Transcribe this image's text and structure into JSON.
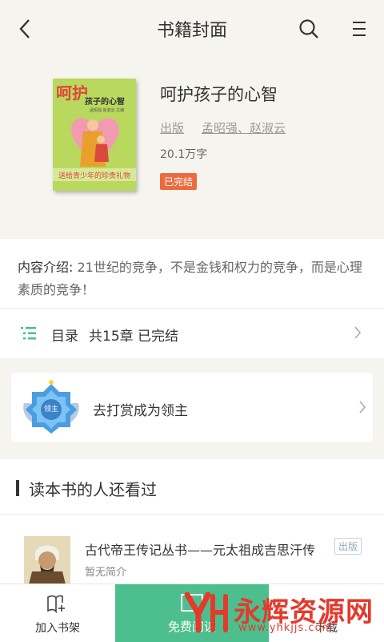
{
  "header": {
    "title": "书籍封面"
  },
  "book": {
    "title": "呵护孩子的心智",
    "publisher": "出版",
    "author": "孟昭强、赵淑云",
    "word_count": "20.1万字",
    "status": "已完结",
    "cover": {
      "big_title": "呵护",
      "sub_title": "孩子的心智",
      "tagline": "送给青少年的珍贵礼物",
      "author_line": "孟昭强 赵淑云 主编"
    }
  },
  "intro": {
    "label": "内容介绍:",
    "text": "21世纪的竞争，不是金钱和权力的竞争，而是心理素质的竞争！"
  },
  "toc": {
    "label": "目录",
    "summary": "共15章 已完结"
  },
  "reward": {
    "badge": "领主",
    "text": "去打赏成为领主"
  },
  "recommend": {
    "section_title": "读本书的人还看过",
    "items": [
      {
        "title": "古代帝王传记丛书——元太祖成吉思汗传",
        "tag": "出版",
        "desc": "暂无简介"
      }
    ]
  },
  "bottom_bar": {
    "add_shelf": "加入书架",
    "read": "免费阅读",
    "download": "下载"
  },
  "watermark": {
    "brand": "永辉资源网",
    "url": "www.yhkjjs.com"
  },
  "colors": {
    "accent_green": "#4dbf8e",
    "status_orange": "#ec6a3c"
  }
}
